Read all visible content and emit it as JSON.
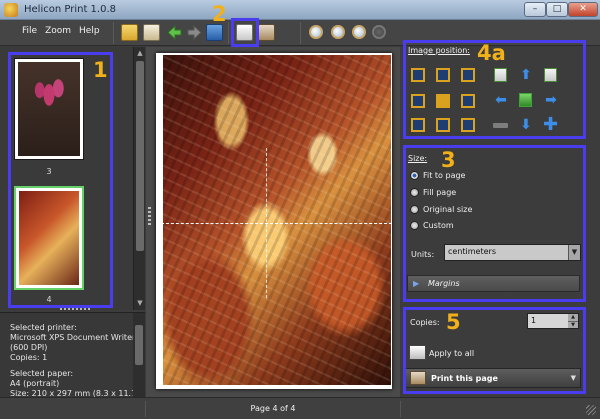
{
  "window": {
    "title": "Helicon Print 1.0.8",
    "minimize": "–",
    "maximize": "□",
    "close": "✕"
  },
  "menu": {
    "items": [
      "File",
      "Zoom",
      "Help"
    ]
  },
  "thumbnails": [
    {
      "label": "3"
    },
    {
      "label": "4"
    }
  ],
  "info": {
    "printer_heading": "Selected printer:",
    "printer_name": "Microsoft XPS Document Writer",
    "printer_dpi": "(600 DPI)",
    "copies": "Copies: 1",
    "paper_heading": "Selected paper:",
    "paper_name": "A4 (portrait)",
    "paper_size": "Size: 210 x 297 mm (8.3 x 11.7"
  },
  "image_position": {
    "title": "Image position:",
    "selected_index": 4
  },
  "size": {
    "title": "Size:",
    "options": [
      "Fit to page",
      "Fill page",
      "Original size",
      "Custom"
    ],
    "selected": "Fit to page",
    "units_label": "Units:",
    "units_value": "centimeters",
    "margins_label": "Margins"
  },
  "print": {
    "copies_label": "Copies:",
    "copies_value": "1",
    "apply_label": "Apply to all",
    "print_label": "Print this page"
  },
  "status": {
    "page": "Page 4 of 4"
  },
  "annotations": {
    "n1": "1",
    "n2": "2",
    "n3": "3",
    "n4a": "4a",
    "n5": "5",
    "color": "#4a3df0",
    "number_color": "#f2b01a"
  },
  "colors": {
    "window_bg": "#3c3c3c",
    "accent_blue": "#3d8ee8",
    "position_gold": "#d9a320",
    "thumb_selected": "#66d069"
  }
}
